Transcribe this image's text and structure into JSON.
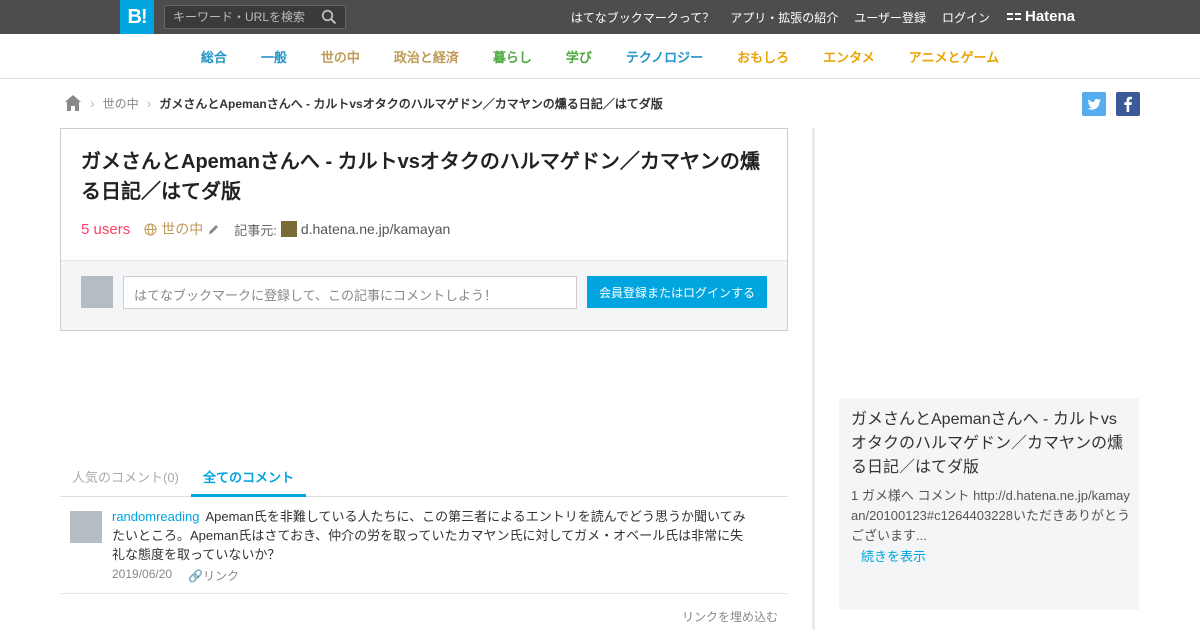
{
  "topbar": {
    "logo": "B!",
    "search_placeholder": "キーワード・URLを検索",
    "links": [
      "はてなブックマークって？",
      "アプリ・拡張の紹介",
      "ユーザー登録",
      "ログイン"
    ],
    "brand": "Hatena"
  },
  "categories": [
    {
      "label": "総合",
      "color": "#2295c7"
    },
    {
      "label": "一般",
      "color": "#2295c7"
    },
    {
      "label": "世の中",
      "color": "#c09a57"
    },
    {
      "label": "政治と経済",
      "color": "#c09a57"
    },
    {
      "label": "暮らし",
      "color": "#4da93f"
    },
    {
      "label": "学び",
      "color": "#4da93f"
    },
    {
      "label": "テクノロジー",
      "color": "#2295c7"
    },
    {
      "label": "おもしろ",
      "color": "#e8a400"
    },
    {
      "label": "エンタメ",
      "color": "#e8a400"
    },
    {
      "label": "アニメとゲーム",
      "color": "#e8a400"
    }
  ],
  "breadcrumb": {
    "category": "世の中",
    "title": "ガメさんとApemanさんへ - カルトvsオタクのハルマゲドン／カマヤンの燻る日記／はてダ版"
  },
  "entry": {
    "title": "ガメさんとApemanさんへ - カルトvsオタクのハルマゲドン／カマヤンの燻る日記／はてダ版",
    "users": "5 users",
    "category": "世の中",
    "source_label": "記事元:",
    "source_domain": "d.hatena.ne.jp/kamayan",
    "comment_placeholder": "はてなブックマークに登録して、この記事にコメントしよう！",
    "login_button": "会員登録またはログインする"
  },
  "tabs": {
    "popular": "人気のコメント(0)",
    "all": "全てのコメント"
  },
  "comments": [
    {
      "user": "randomreading",
      "text": "Apeman氏を非難している人たちに、この第三者によるエントリを読んでどう思うか聞いてみたいところ。Apeman氏はさておき、仲介の労を取っていたカマヤン氏に対してガメ・オベール氏は非常に失礼な態度を取っていないか？",
      "date": "2019/06/20",
      "link_label": "リンク"
    }
  ],
  "embed_label": "リンクを埋め込む",
  "sidebar": {
    "title": "ガメさんとApemanさんへ - カルトvsオタクのハルマゲドン／カマヤンの燻る日記／はてダ版",
    "text": "1 ガメ様へ コメント http://d.hatena.ne.jp/kamayan/20100123#c1264403228いただきありがとうございます...",
    "more": "続きを表示"
  }
}
